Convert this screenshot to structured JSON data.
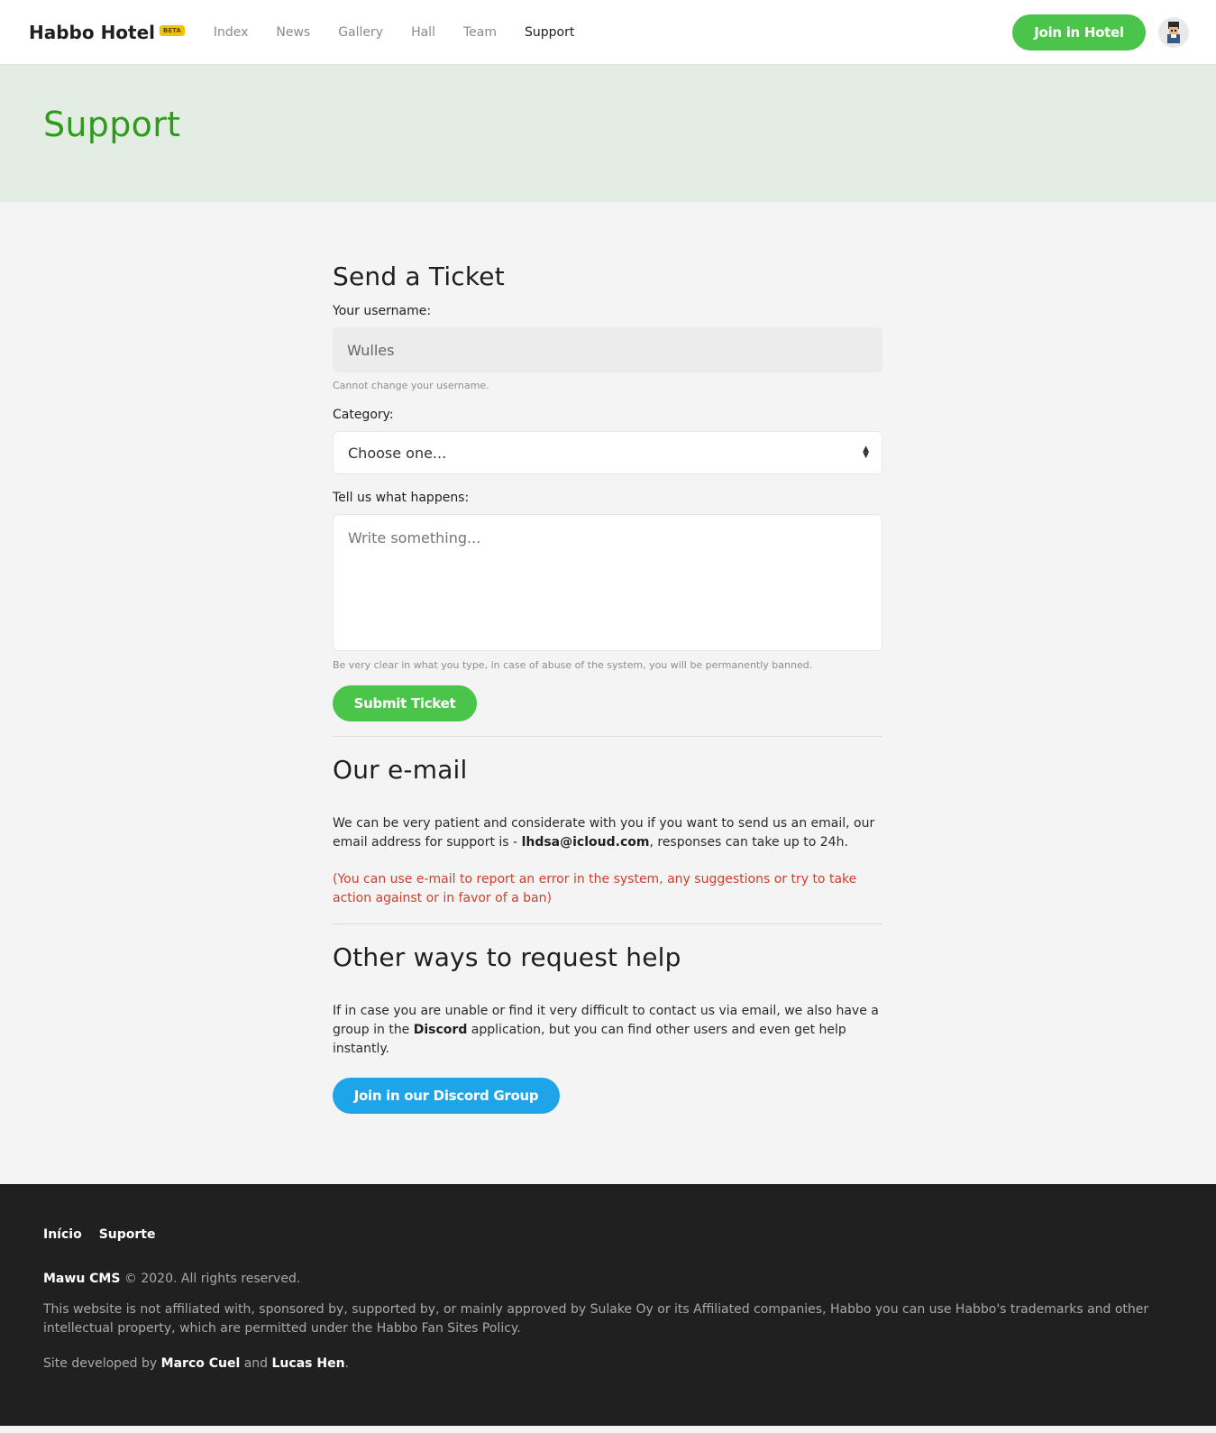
{
  "header": {
    "brand": "Habbo Hotel",
    "badge": "BETA",
    "nav": [
      {
        "label": "Index",
        "active": false
      },
      {
        "label": "News",
        "active": false
      },
      {
        "label": "Gallery",
        "active": false
      },
      {
        "label": "Hall",
        "active": false
      },
      {
        "label": "Team",
        "active": false
      },
      {
        "label": "Support",
        "active": true
      }
    ],
    "join_button": "Join in Hotel",
    "avatar_icon": "user-avatar-icon"
  },
  "hero": {
    "title": "Support"
  },
  "ticket": {
    "heading": "Send a Ticket",
    "username_label": "Your username:",
    "username_value": "Wulles",
    "username_hint": "Cannot change your username.",
    "category_label": "Category:",
    "category_selected": "Choose one...",
    "message_label": "Tell us what happens:",
    "message_placeholder": "Write something...",
    "message_hint": "Be very clear in what you type, in case of abuse of the system, you will be permanently banned.",
    "submit_button": "Submit Ticket"
  },
  "email_section": {
    "heading": "Our e-mail",
    "text_before": "We can be very patient and considerate with you if you want to send us an email, our email address for support is - ",
    "email": "lhdsa@icloud.com",
    "text_after": ", responses can take up to 24h.",
    "notice": "(You can use e-mail to report an error in the system, any suggestions or try to take action against or in favor of a ban)"
  },
  "help_section": {
    "heading": "Other ways to request help",
    "text_before": "If in case you are unable or find it very difficult to contact us via email, we also have a group in the ",
    "discord": "Discord",
    "text_after": " application, but you can find other users and even get help instantly.",
    "discord_button": "Join in our Discord Group"
  },
  "footer": {
    "links": [
      "Início",
      "Suporte"
    ],
    "cms_name": "Mawu CMS",
    "copyright": " © 2020. All rights reserved.",
    "disclaimer": "This website is not affiliated with, sponsored by, supported by, or mainly approved by Sulake Oy or its Affiliated companies, Habbo you can use Habbo's trademarks and other intellectual property, which are permitted under the Habbo Fan Sites Policy.",
    "dev_prefix": "Site developed by ",
    "dev1": "Marco Cuel",
    "dev_and": " and ",
    "dev2": "Lucas Hen",
    "dev_suffix": "."
  },
  "colors": {
    "accent_green": "#4ac54a",
    "title_green": "#2f9a1c",
    "hero_bg": "#e3ede3",
    "discord_blue": "#1ea4e8",
    "notice_red": "#d43d2a",
    "footer_bg": "#202020"
  }
}
